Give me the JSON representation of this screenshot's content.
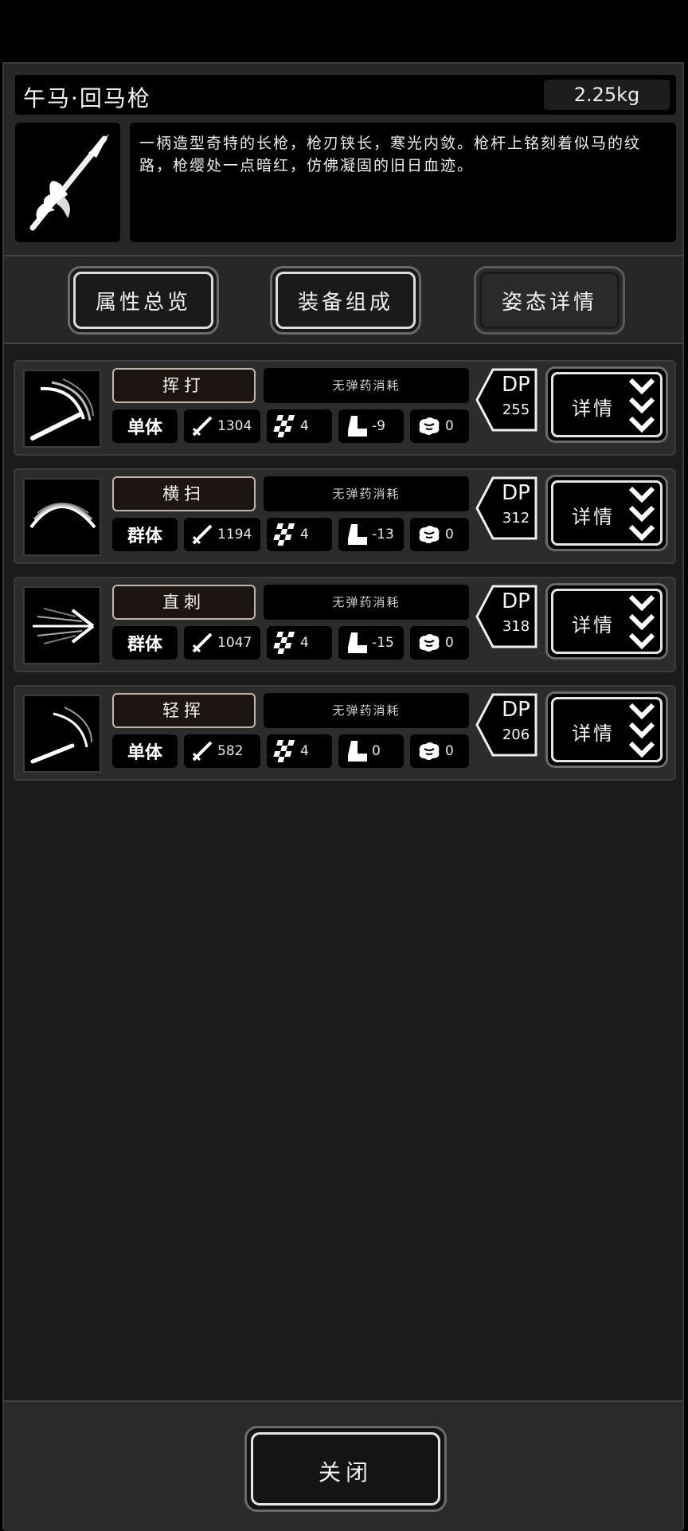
{
  "item": {
    "name": "午马·回马枪",
    "weight": "2.25kg",
    "icon": "spear-icon",
    "description": "一柄造型奇特的长枪，枪刃铗长，寒光内敛。枪杆上铭刻着似马的纹路，枪缨处一点暗红，仿佛凝固的旧日血迹。"
  },
  "tabs": [
    {
      "label": "属性总览",
      "active": false
    },
    {
      "label": "装备组成",
      "active": false
    },
    {
      "label": "姿态详情",
      "active": true
    }
  ],
  "skills": [
    {
      "name": "挥打",
      "cost": "无弹药消耗",
      "target": "单体",
      "attack": "1304",
      "hit": "4",
      "move": "-9",
      "brain": "0",
      "dp_label": "DP",
      "dp": "255",
      "icon": "swing-slash-icon",
      "detail": "详情"
    },
    {
      "name": "横扫",
      "cost": "无弹药消耗",
      "target": "群体",
      "attack": "1194",
      "hit": "4",
      "move": "-13",
      "brain": "0",
      "dp_label": "DP",
      "dp": "312",
      "icon": "sweep-arc-icon",
      "detail": "详情"
    },
    {
      "name": "直刺",
      "cost": "无弹药消耗",
      "target": "群体",
      "attack": "1047",
      "hit": "4",
      "move": "-15",
      "brain": "0",
      "dp_label": "DP",
      "dp": "318",
      "icon": "thrust-icon",
      "detail": "详情"
    },
    {
      "name": "轻挥",
      "cost": "无弹药消耗",
      "target": "单体",
      "attack": "582",
      "hit": "4",
      "move": "0",
      "brain": "0",
      "dp_label": "DP",
      "dp": "206",
      "icon": "light-swing-icon",
      "detail": "详情"
    }
  ],
  "footer": {
    "close_label": "关闭"
  },
  "colors": {
    "background": "#1b1b1b",
    "header": "#272727",
    "card": "#2c2c2c",
    "accent": "#e4e4e4"
  }
}
